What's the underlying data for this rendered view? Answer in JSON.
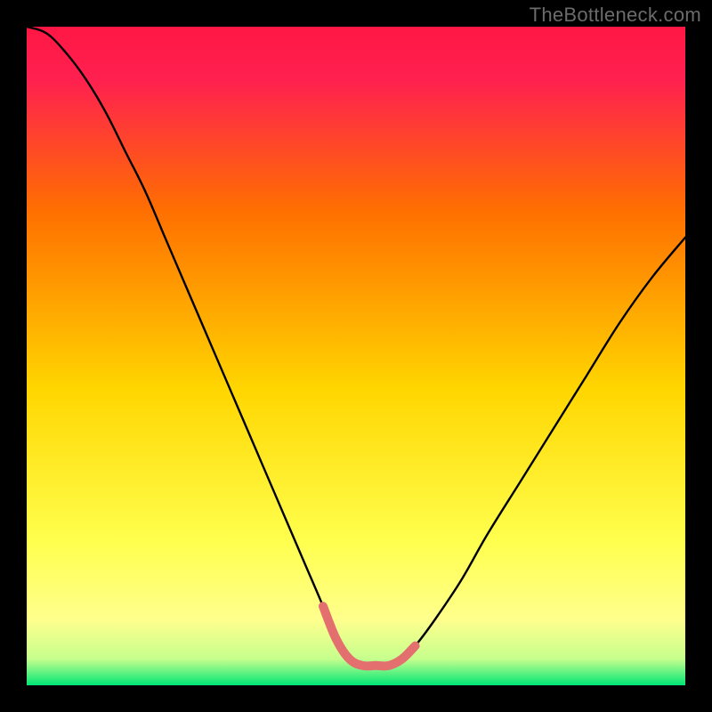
{
  "watermark": "TheBottleneck.com",
  "chart_data": {
    "type": "line",
    "title": "",
    "xlabel": "",
    "ylabel": "",
    "xlim": [
      0,
      100
    ],
    "ylim": [
      0,
      100
    ],
    "grid": false,
    "legend": false,
    "gradient_colors": {
      "top": "#ff1744",
      "upper_mid": "#ff6f00",
      "mid": "#ffd600",
      "lower": "#ffff8d",
      "bottom": "#00e676"
    },
    "series": [
      {
        "name": "bottleneck-curve",
        "color": "#000000",
        "x": [
          0,
          3,
          6,
          9,
          12,
          15,
          18,
          21,
          24,
          27,
          30,
          33,
          36,
          39,
          42,
          45,
          47,
          49,
          51,
          53,
          55,
          57,
          59,
          62,
          66,
          70,
          75,
          80,
          85,
          90,
          95,
          100
        ],
        "y": [
          100,
          99,
          96,
          92,
          87,
          81,
          75,
          68,
          61,
          54,
          47,
          40,
          33,
          26,
          19,
          12,
          7,
          4,
          3,
          3,
          3,
          4,
          6,
          10,
          16,
          23,
          31,
          39,
          47,
          55,
          62,
          68
        ]
      },
      {
        "name": "optimal-segment",
        "color": "#e36f6f",
        "x": [
          45,
          47,
          49,
          51,
          53,
          55,
          57,
          59
        ],
        "y": [
          12,
          7,
          4,
          3,
          3,
          3,
          4,
          6
        ]
      }
    ]
  }
}
